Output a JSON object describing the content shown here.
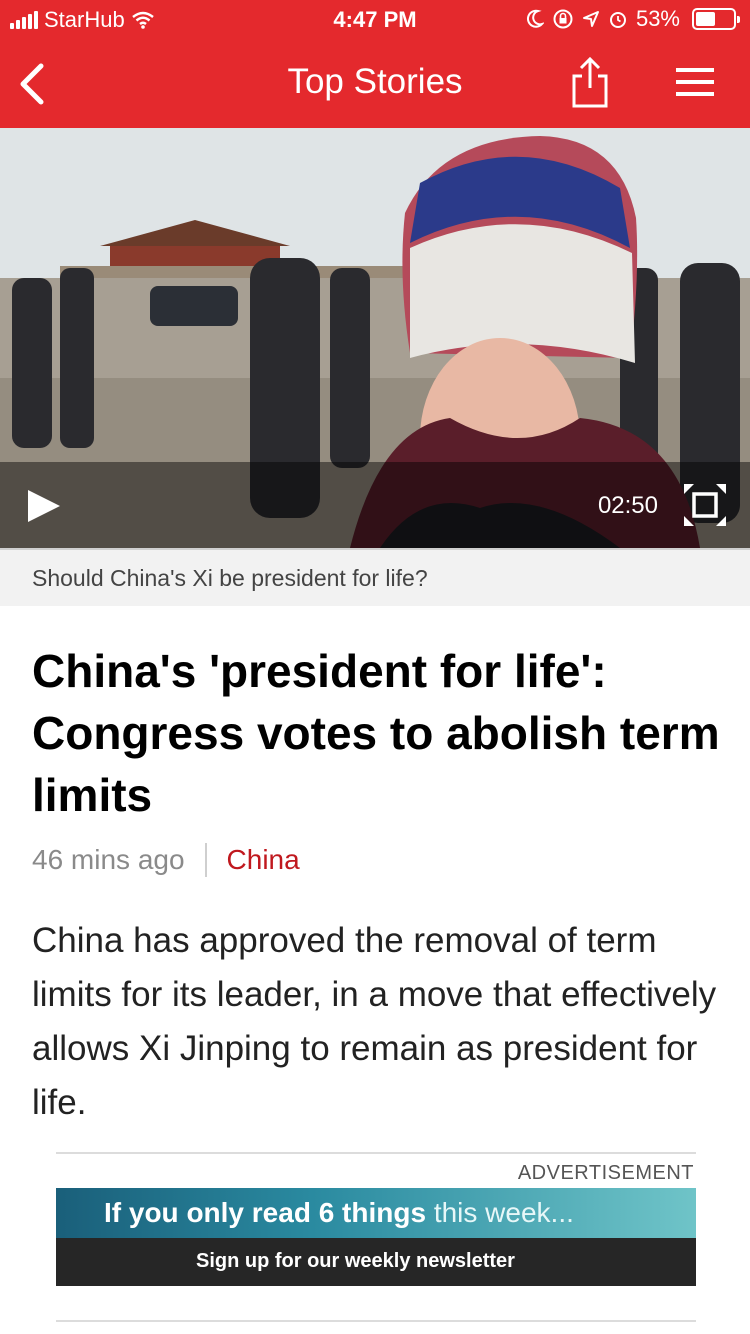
{
  "status_bar": {
    "carrier": "StarHub",
    "time": "4:47 PM",
    "battery_percent": "53%",
    "battery_level": 0.53
  },
  "navbar": {
    "title": "Top Stories",
    "back_icon": "chevron-left-icon",
    "share_icon": "share-icon",
    "menu_icon": "hamburger-menu-icon"
  },
  "video": {
    "duration": "02:50",
    "caption": "Should China's Xi be president for life?"
  },
  "article": {
    "headline": "China's 'president for life': Congress votes to abolish term limits",
    "time_ago": "46 mins ago",
    "section": "China",
    "summary": "China has approved the removal of term limits for its leader, in a move that effectively allows Xi Jinping to remain as president for life."
  },
  "ad": {
    "label": "ADVERTISEMENT",
    "headline_bold": "If you only read 6 things",
    "headline_light": "this week...",
    "cta": "Sign up for our weekly newsletter"
  },
  "colors": {
    "brand_red": "#e4292d",
    "section_red": "#c0181e"
  }
}
